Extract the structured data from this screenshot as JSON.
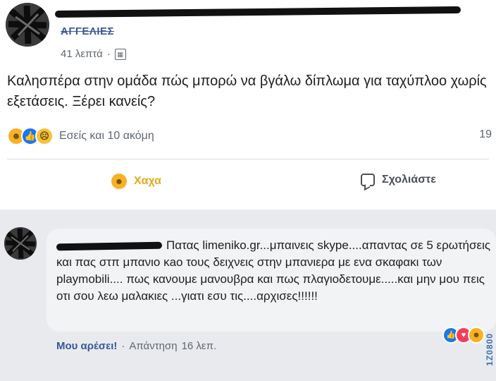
{
  "post": {
    "author_sub": "ΑΓΓΕΛΙΕΣ",
    "time": "41 λεπτά",
    "time_sep": "·",
    "privacy_icon": "group-icon",
    "text": "Καλησπέρα στην ομάδα πώς μπορώ να βγάλω δίπλωμα για ταχύπλοο χωρίς εξετάσεις. Ξέρει κανείς?",
    "reactions_text": "Εσείς και 10 ακόμη",
    "comment_count": "19",
    "actions": {
      "haha_label": "Χαχα",
      "comment_label": "Σχολιάστε"
    }
  },
  "comment": {
    "text": "Πατας limeniko.gr...μπαινεις skype....απαντας σε 5 ερωτήσεις και πας στπ μπανιο κao τους δειχνεις στην μπανιερα με ενα σκαφακι των playmobili.... πως κανουμε μανουβρα και πως πλαγιοδετουμε.....και μην μου πεις οτι σου λεω μαλακιες ...γιατι εσυ τις....αρχισες!!!!!!",
    "like_label": "Μου αρέσει!",
    "sep": "·",
    "reply_label": "Απάντηση",
    "time": "16 λεπ."
  },
  "watermark": "1Z0800",
  "colors": {
    "link_blue": "#385898",
    "haha_yellow": "#f7b125",
    "like_blue": "#1877f2",
    "love_red": "#f33e58"
  }
}
